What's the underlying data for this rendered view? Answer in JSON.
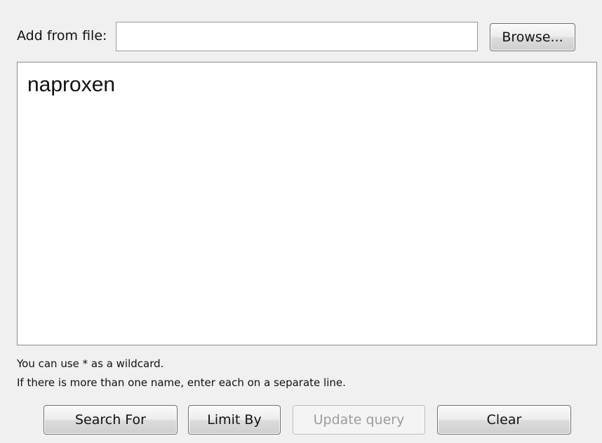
{
  "file_row": {
    "label": "Add from file:",
    "input_value": "",
    "browse_label": "Browse..."
  },
  "names_box": {
    "value": "naproxen"
  },
  "hints": {
    "wildcard": "You can use * as a wildcard.",
    "multiple": "If there is more than one name, enter each on a separate line."
  },
  "actions": {
    "search_for": "Search For",
    "limit_by": "Limit By",
    "update_query": "Update query",
    "clear": "Clear"
  }
}
